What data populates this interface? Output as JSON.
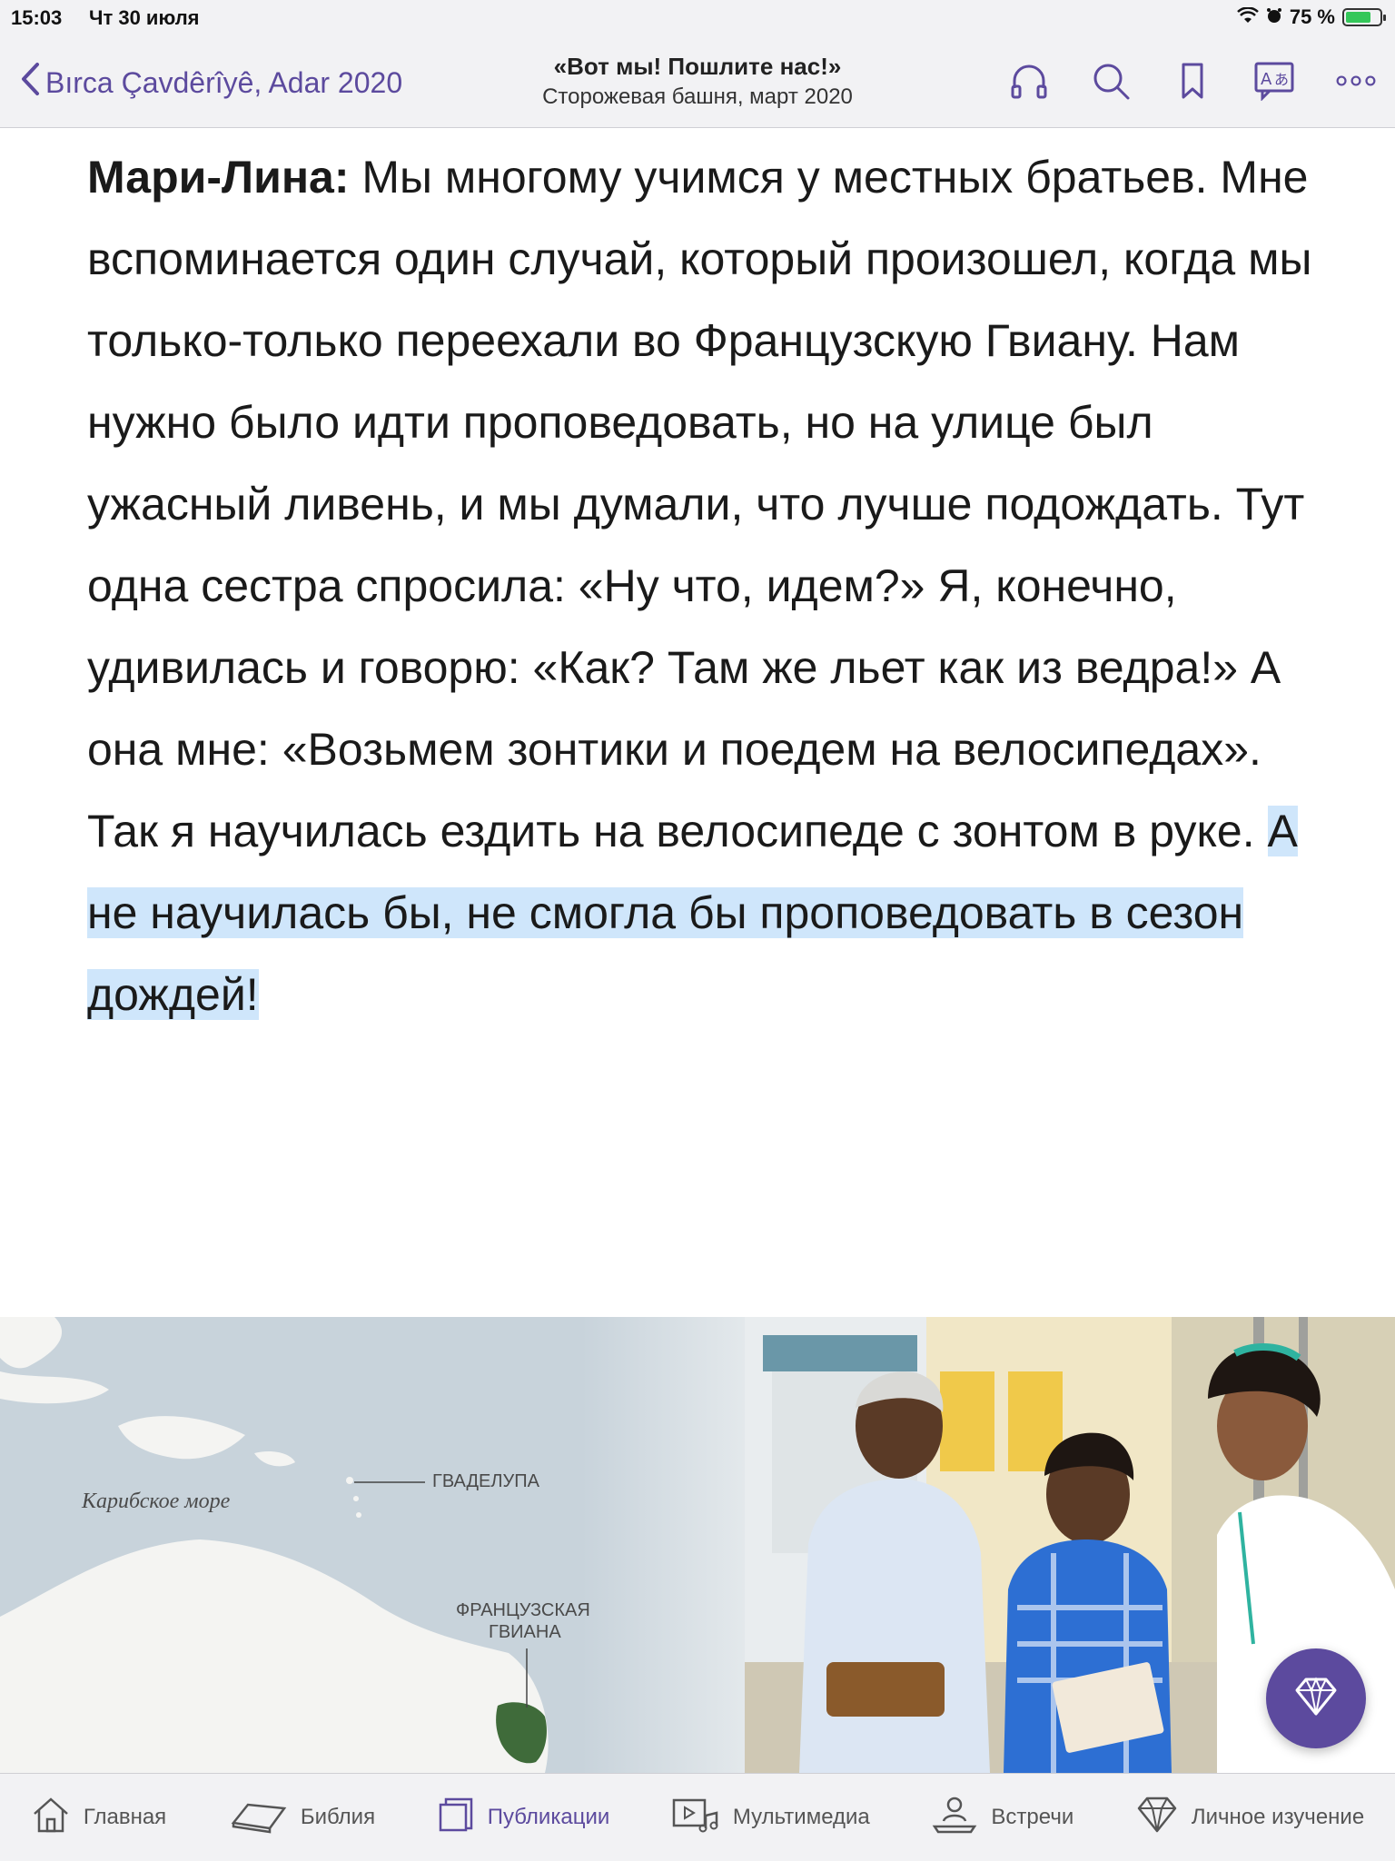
{
  "status": {
    "time": "15:03",
    "date": "Чт 30 июля",
    "battery": "75 %",
    "battery_level": 0.75
  },
  "nav": {
    "back_label": "Bırca Çavdêrîyê, Adar 2020",
    "title": "«Вот мы! Пошлите нас!»",
    "subtitle": "Сторожевая башня, март 2020",
    "icons": [
      "headphones-icon",
      "search-icon",
      "bookmark-icon",
      "language-icon",
      "more-icon"
    ]
  },
  "article": {
    "speaker": "Мари-Лина:",
    "text": " Мы многому учимся у местных братьев. Мне вспоминается один случай, который произошел, когда мы только-только переехали во Французскую Гвиану. Нам нужно было идти проповедовать, но на улице был ужасный ливень, и мы думали, что лучше подождать. Тут одна сестра спросила: «Ну что, идем?» Я, конечно, удивилась и говорю: «Как? Там же льет как из ведра!» А она мне: «Возьмем зонтики и поедем на велосипедах». Так я научилась ездить на велосипеде с зонтом в руке.",
    "highlighted": "А не научилась бы, не смогла бы проповедовать в сезон дождей!"
  },
  "map": {
    "sea_label": "Карибское море",
    "guadeloupe_label": "ГВАДЕЛУПА",
    "guiana_label_1": "ФРАНЦУЗСКАЯ",
    "guiana_label_2": "ГВИАНА"
  },
  "tabs": [
    {
      "label": "Главная",
      "icon": "home-icon",
      "active": false
    },
    {
      "label": "Библия",
      "icon": "bible-icon",
      "active": false
    },
    {
      "label": "Публикации",
      "icon": "publications-icon",
      "active": true
    },
    {
      "label": "Мультимедиа",
      "icon": "media-icon",
      "active": false
    },
    {
      "label": "Встречи",
      "icon": "meetings-icon",
      "active": false
    },
    {
      "label": "Личное изучение",
      "icon": "study-icon",
      "active": false
    }
  ],
  "colors": {
    "accent": "#5c4a9e",
    "highlight": "#cfe6fb"
  }
}
